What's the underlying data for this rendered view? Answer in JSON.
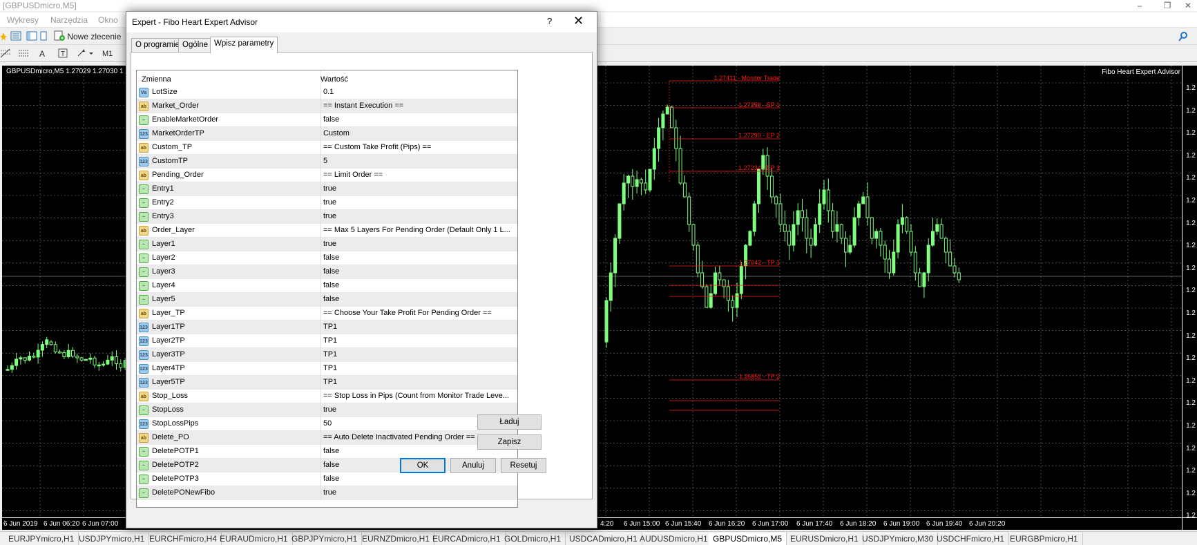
{
  "window": {
    "title": "[GBPUSDmicro,M5]",
    "controls": [
      "–",
      "❐",
      "✕"
    ]
  },
  "menubar": [
    "Wykresy",
    "Narzędzia",
    "Okno"
  ],
  "toolbar": {
    "new_order_label": "Nowe zlecenie",
    "timeframe_label": "M1"
  },
  "chart": {
    "header": "GBPUSDmicro,M5  1.27029 1.27030 1",
    "ea_label": "Fibo Heart Expert Advisor",
    "price_labels": [
      "1.2",
      "1.2",
      "1.2",
      "1.2",
      "1.2",
      "1.2",
      "1.2",
      "1.2",
      "1.2",
      "1.2",
      "1.2",
      "1.2",
      "1.2",
      "1.2",
      "1.2",
      "1.2",
      "1.2",
      "1.2",
      "1.2",
      "1.2",
      "1.2"
    ],
    "time_labels_left": [
      "6 Jun 2019",
      "6 Jun 06:20",
      "6 Jun 07:00"
    ],
    "time_labels_right": [
      "4:20",
      "6 Jun 15:00",
      "6 Jun 15:40",
      "6 Jun 16:20",
      "6 Jun 17:00",
      "6 Jun 17:40",
      "6 Jun 18:20",
      "6 Jun 19:00",
      "6 Jun 19:40",
      "6 Jun 20:20"
    ],
    "fibo_labels": [
      "1.27411 - Monitor Trade",
      "1.27358 - EP 1",
      "1.27299 - EP 2",
      "1.27234 - EP 3",
      "1.27042 - TP 1",
      "1.26852 - TP 2"
    ],
    "colors": {
      "background": "#000000",
      "candle": "#7fff7f",
      "fibo": "#ff1a1a",
      "grid": "#7f7f7f"
    }
  },
  "symbol_tabs": [
    {
      "label": "EURJPYmicro,H1",
      "active": false
    },
    {
      "label": "USDJPYmicro,H1",
      "active": false
    },
    {
      "label": "EURCHFmicro,H4",
      "active": false
    },
    {
      "label": "EURAUDmicro,H1",
      "active": false
    },
    {
      "label": "GBPJPYmicro,H1",
      "active": false
    },
    {
      "label": "EURNZDmicro,H1",
      "active": false
    },
    {
      "label": "EURCADmicro,H1",
      "active": false
    },
    {
      "label": "GOLDmicro,H1",
      "active": false
    },
    {
      "label": "USDCADmicro,H1",
      "active": false
    },
    {
      "label": "AUDUSDmicro,H1",
      "active": false
    },
    {
      "label": "GBPUSDmicro,M5",
      "active": true
    },
    {
      "label": "EURUSDmicro,H1",
      "active": false
    },
    {
      "label": "USDJPYmicro,M30",
      "active": false
    },
    {
      "label": "USDCHFmicro,H1",
      "active": false
    },
    {
      "label": "EURGBPmicro,H1",
      "active": false
    }
  ],
  "dialog": {
    "title": "Expert - Fibo Heart Expert Advisor",
    "help": "?",
    "close": "✕",
    "tabs": [
      "O programie",
      "Ogólne",
      "Wpisz parametry"
    ],
    "col_name": "Zmienna",
    "col_value": "Wartość",
    "params": [
      {
        "name": "LotSize",
        "value": "0.1",
        "type": "double",
        "icon": "Va"
      },
      {
        "name": "Market_Order",
        "value": "== Instant Execution ==",
        "type": "string",
        "icon": "ab"
      },
      {
        "name": "EnableMarketOrder",
        "value": "false",
        "type": "bool",
        "icon": "~"
      },
      {
        "name": "MarketOrderTP",
        "value": "Custom",
        "type": "enum",
        "icon": "123"
      },
      {
        "name": "Custom_TP",
        "value": "== Custom Take Profit (Pips) ==",
        "type": "string",
        "icon": "ab"
      },
      {
        "name": "CustomTP",
        "value": "5",
        "type": "enum",
        "icon": "123"
      },
      {
        "name": "Pending_Order",
        "value": "== Limit Order ==",
        "type": "string",
        "icon": "ab"
      },
      {
        "name": "Entry1",
        "value": "true",
        "type": "bool",
        "icon": "~"
      },
      {
        "name": "Entry2",
        "value": "true",
        "type": "bool",
        "icon": "~"
      },
      {
        "name": "Entry3",
        "value": "true",
        "type": "bool",
        "icon": "~"
      },
      {
        "name": "Order_Layer",
        "value": "== Max 5 Layers For Pending Order (Default Only 1 L...",
        "type": "string",
        "icon": "ab"
      },
      {
        "name": "Layer1",
        "value": "true",
        "type": "bool",
        "icon": "~"
      },
      {
        "name": "Layer2",
        "value": "false",
        "type": "bool",
        "icon": "~"
      },
      {
        "name": "Layer3",
        "value": "false",
        "type": "bool",
        "icon": "~"
      },
      {
        "name": "Layer4",
        "value": "false",
        "type": "bool",
        "icon": "~"
      },
      {
        "name": "Layer5",
        "value": "false",
        "type": "bool",
        "icon": "~"
      },
      {
        "name": "Layer_TP",
        "value": "== Choose Your Take Profit For Pending Order ==",
        "type": "string",
        "icon": "ab"
      },
      {
        "name": "Layer1TP",
        "value": "TP1",
        "type": "enum",
        "icon": "123"
      },
      {
        "name": "Layer2TP",
        "value": "TP1",
        "type": "enum",
        "icon": "123"
      },
      {
        "name": "Layer3TP",
        "value": "TP1",
        "type": "enum",
        "icon": "123"
      },
      {
        "name": "Layer4TP",
        "value": "TP1",
        "type": "enum",
        "icon": "123"
      },
      {
        "name": "Layer5TP",
        "value": "TP1",
        "type": "enum",
        "icon": "123"
      },
      {
        "name": "Stop_Loss",
        "value": "== Stop Loss in Pips (Count from Monitor Trade Leve...",
        "type": "string",
        "icon": "ab"
      },
      {
        "name": "StopLoss",
        "value": "true",
        "type": "bool",
        "icon": "~"
      },
      {
        "name": "StopLossPips",
        "value": "50",
        "type": "enum",
        "icon": "123"
      },
      {
        "name": "Delete_PO",
        "value": "== Auto Delete Inactivated Pending Order ==",
        "type": "string",
        "icon": "ab"
      },
      {
        "name": "DeletePOTP1",
        "value": "false",
        "type": "bool",
        "icon": "~"
      },
      {
        "name": "DeletePOTP2",
        "value": "false",
        "type": "bool",
        "icon": "~"
      },
      {
        "name": "DeletePOTP3",
        "value": "false",
        "type": "bool",
        "icon": "~"
      },
      {
        "name": "DeletePONewFibo",
        "value": "true",
        "type": "bool",
        "icon": "~"
      }
    ],
    "buttons": {
      "load": "Ładuj",
      "save": "Zapisz",
      "ok": "OK",
      "cancel": "Anuluj",
      "reset": "Resetuj"
    }
  }
}
